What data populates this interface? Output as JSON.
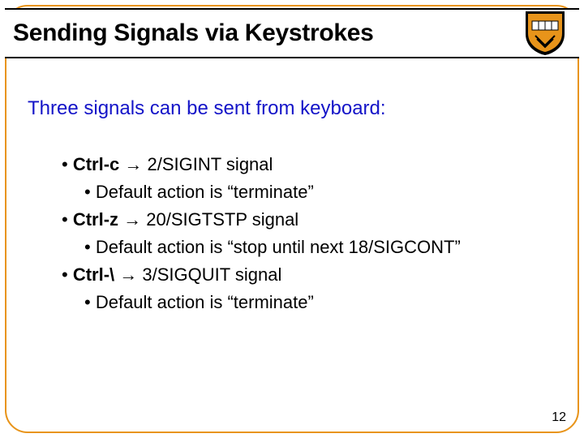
{
  "title": "Sending Signals via Keystrokes",
  "lead": "Three signals can be sent from keyboard:",
  "items": [
    {
      "key": "Ctrl-c",
      "arrow": "→",
      "sig": " 2/SIGINT signal",
      "sub": "Default action is “terminate”"
    },
    {
      "key": "Ctrl-z",
      "arrow": "→",
      "sig": " 20/SIGTSTP signal",
      "sub": "Default action is “stop until next 18/SIGCONT”"
    },
    {
      "key": "Ctrl-\\",
      "arrow": "→",
      "sig": " 3/SIGQUIT signal",
      "sub": "Default action is “terminate”"
    }
  ],
  "page": "12"
}
